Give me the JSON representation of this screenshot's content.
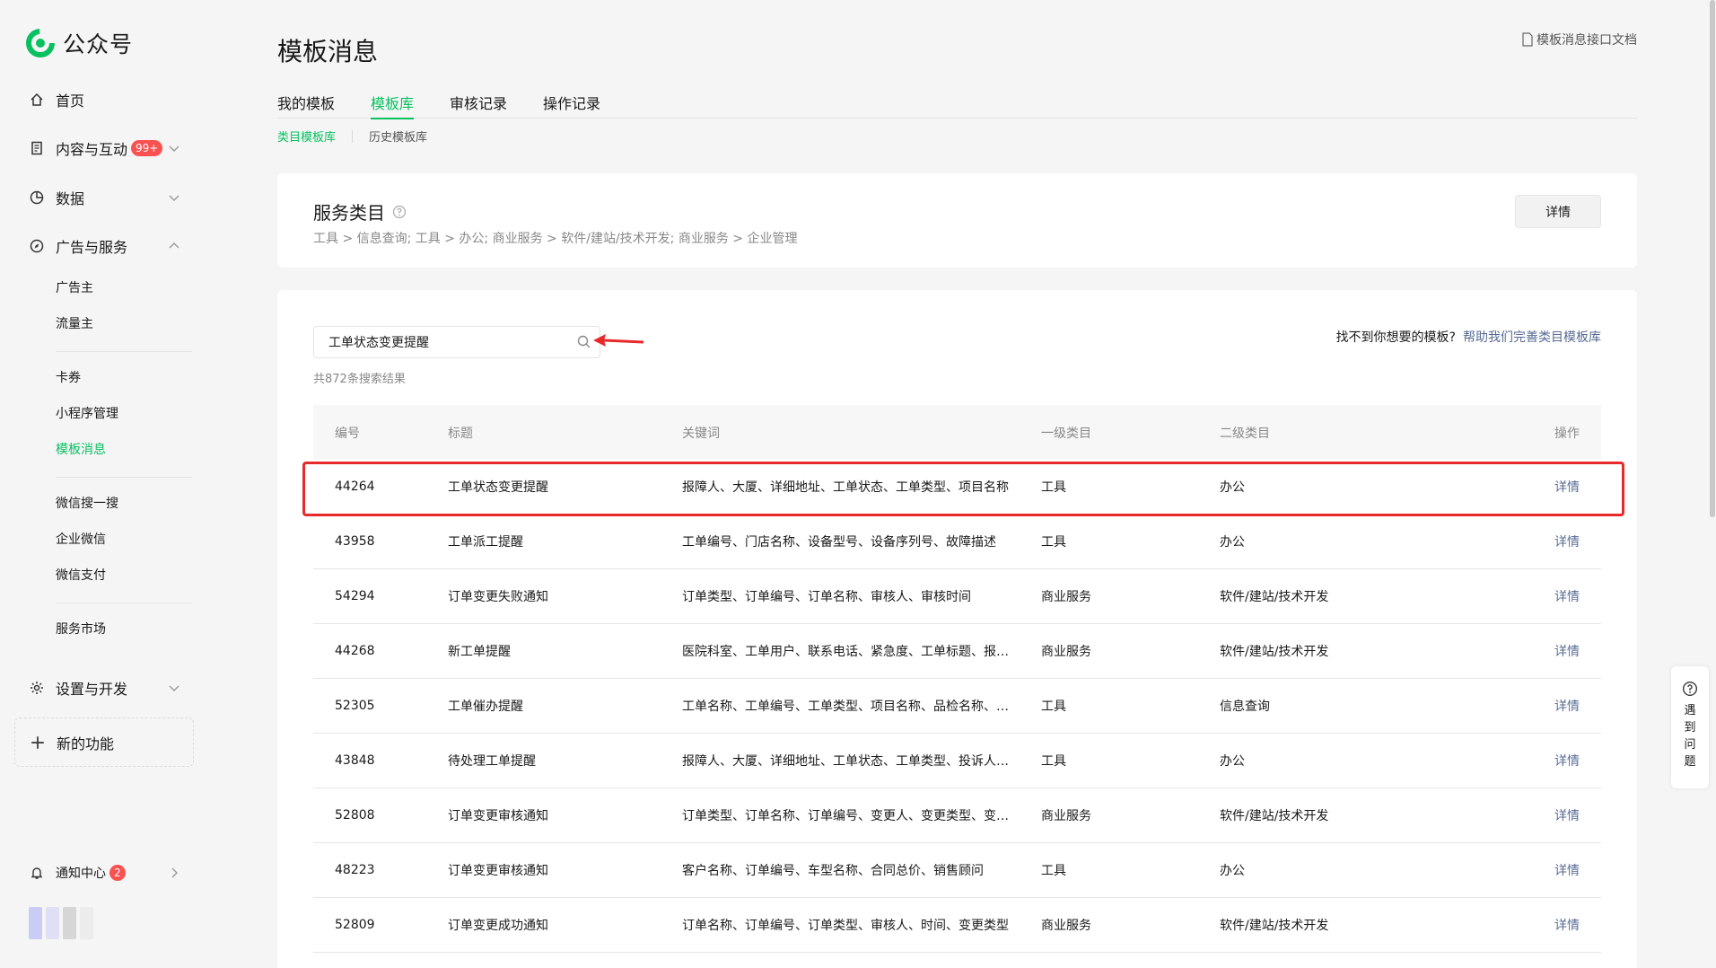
{
  "app": {
    "name": "公众号",
    "brand_color": "#07c160"
  },
  "sidebar": {
    "home": "首页",
    "content": {
      "label": "内容与互动",
      "badge": "99+"
    },
    "data": "数据",
    "ads": "广告与服务",
    "ads_items": [
      "广告主",
      "流量主"
    ],
    "tools_items": [
      "卡券",
      "小程序管理",
      "模板消息"
    ],
    "more_items": [
      "微信搜一搜",
      "企业微信",
      "微信支付"
    ],
    "market": "服务市场",
    "settings": "设置与开发",
    "new_feature": "新的功能",
    "notify": {
      "label": "通知中心",
      "badge": "2"
    }
  },
  "header": {
    "title": "模板消息",
    "doc_link": "模板消息接口文档"
  },
  "tabs": [
    "我的模板",
    "模板库",
    "审核记录",
    "操作记录"
  ],
  "subtabs": [
    "类目模板库",
    "历史模板库"
  ],
  "category": {
    "title": "服务类目",
    "breadcrumb": "工具 > 信息查询; 工具 > 办公; 商业服务 > 软件/建站/技术开发; 商业服务 > 企业管理",
    "detail_button": "详情"
  },
  "search": {
    "value": "工单状态变更提醒",
    "result_count": "共872条搜索结果",
    "feedback_text": "找不到你想要的模板?",
    "feedback_link": "帮助我们完善类目模板库"
  },
  "table": {
    "headers": [
      "编号",
      "标题",
      "关键词",
      "一级类目",
      "二级类目",
      "操作"
    ],
    "rows": [
      [
        "44264",
        "工单状态变更提醒",
        "报障人、大厦、详细地址、工单状态、工单类型、项目名称",
        "工具",
        "办公",
        "详情"
      ],
      [
        "43958",
        "工单派工提醒",
        "工单编号、门店名称、设备型号、设备序列号、故障描述",
        "工具",
        "办公",
        "详情"
      ],
      [
        "54294",
        "订单变更失败通知",
        "订单类型、订单编号、订单名称、审核人、审核时间",
        "商业服务",
        "软件/建站/技术开发",
        "详情"
      ],
      [
        "44268",
        "新工单提醒",
        "医院科室、工单用户、联系电话、紧急度、工单标题、报修时间",
        "商业服务",
        "软件/建站/技术开发",
        "详情"
      ],
      [
        "52305",
        "工单催办提醒",
        "工单名称、工单编号、工单类型、项目名称、品检名称、工单状态",
        "工具",
        "信息查询",
        "详情"
      ],
      [
        "43848",
        "待处理工单提醒",
        "报障人、大厦、详细地址、工单状态、工单类型、投诉人电话",
        "工具",
        "办公",
        "详情"
      ],
      [
        "52808",
        "订单变更审核通知",
        "订单类型、订单名称、订单编号、变更人、变更类型、变更时间",
        "商业服务",
        "软件/建站/技术开发",
        "详情"
      ],
      [
        "48223",
        "订单变更审核通知",
        "客户名称、订单编号、车型名称、合同总价、销售顾问",
        "工具",
        "办公",
        "详情"
      ],
      [
        "52809",
        "订单变更成功通知",
        "订单名称、订单编号、订单类型、审核人、时间、变更类型",
        "商业服务",
        "软件/建站/技术开发",
        "详情"
      ]
    ]
  },
  "float_help": "遇到问题"
}
